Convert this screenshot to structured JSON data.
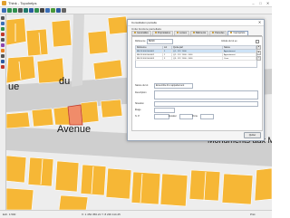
{
  "window": {
    "title": "Think - Topohelps",
    "controls": [
      "–",
      "□",
      "✕"
    ]
  },
  "toolbar": {
    "icons": [
      "pointer-icon",
      "zoom-in-icon",
      "zoom-out-icon",
      "pan-icon",
      "layers-icon",
      "select-icon",
      "measure-icon",
      "print-icon",
      "save-icon",
      "refresh-icon",
      "info-icon",
      "search-icon"
    ]
  },
  "colors": {
    "parcel": "#f6b736",
    "road": "#c8c8c8",
    "selected_parcel": "#f08c6a",
    "dialog_border": "#9aa7b8",
    "tab_active_border": "#8aa0bf",
    "grid_selection": "#cde3f7"
  },
  "map": {
    "street_labels": [
      "ue",
      "du",
      "Avenue",
      "Monuments aux Mor"
    ]
  },
  "dialog": {
    "title": "Consultation parcelle",
    "close": "✕",
    "subtitle": "Unité foncière parcellaire",
    "tabs": [
      "Généralités",
      "Propriétaires",
      "Locaux",
      "Bâtiments",
      "Parcelles",
      "Copropriété"
    ],
    "active_tab_index": 5,
    "reference_label": "Référence",
    "reference_value": "BM18",
    "filter_label": "Intitulé du lot ex.",
    "columns": [
      "Référence",
      "Lot",
      "Quote-part",
      "Nature"
    ],
    "rows": [
      {
        "ref": "BM 18 0001 A 0001",
        "lot": "1",
        "quote": "Q1 - 1/2 / 1000",
        "nature": "Appartement"
      },
      {
        "ref": "BM 18 0001 A 0002",
        "lot": "2",
        "quote": "Q2 - 1/1 / 1000 - 1000",
        "nature": "Appartement"
      },
      {
        "ref": "BM 18 0001 A 0003",
        "lot": "3",
        "quote": "Q3 - 1/2 / 1000 - 1000",
        "nature": "Cave"
      }
    ],
    "selected_row_index": 0,
    "side_buttons": [
      "▲",
      "▼",
      "+"
    ],
    "nature_label": "Nature du lot",
    "nature_value": "Ensemble d'un appartement",
    "description_label": "Description",
    "situation_label": "Situation",
    "number_label": "N. P.",
    "floor_label": "Étage",
    "stairs_label": "Escalier",
    "porte_label": "Porte",
    "button_label": "Quitter"
  },
  "status": {
    "left": "Ech. 1:500",
    "coords": "X: 1 452 356.21   Y: 8 236 114.45",
    "right": "Prêt"
  }
}
